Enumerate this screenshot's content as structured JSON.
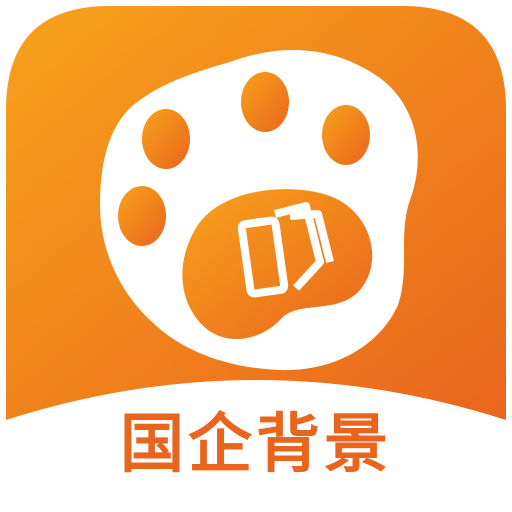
{
  "app_icon": {
    "icon": "paw-with-cards-icon",
    "caption": "国企背景",
    "colors": {
      "gradient_start": "#F8A21C",
      "gradient_end": "#E9651D",
      "paw": "#FFFFFF",
      "caption": "#E9651D",
      "background": "#FFFFFF"
    }
  }
}
